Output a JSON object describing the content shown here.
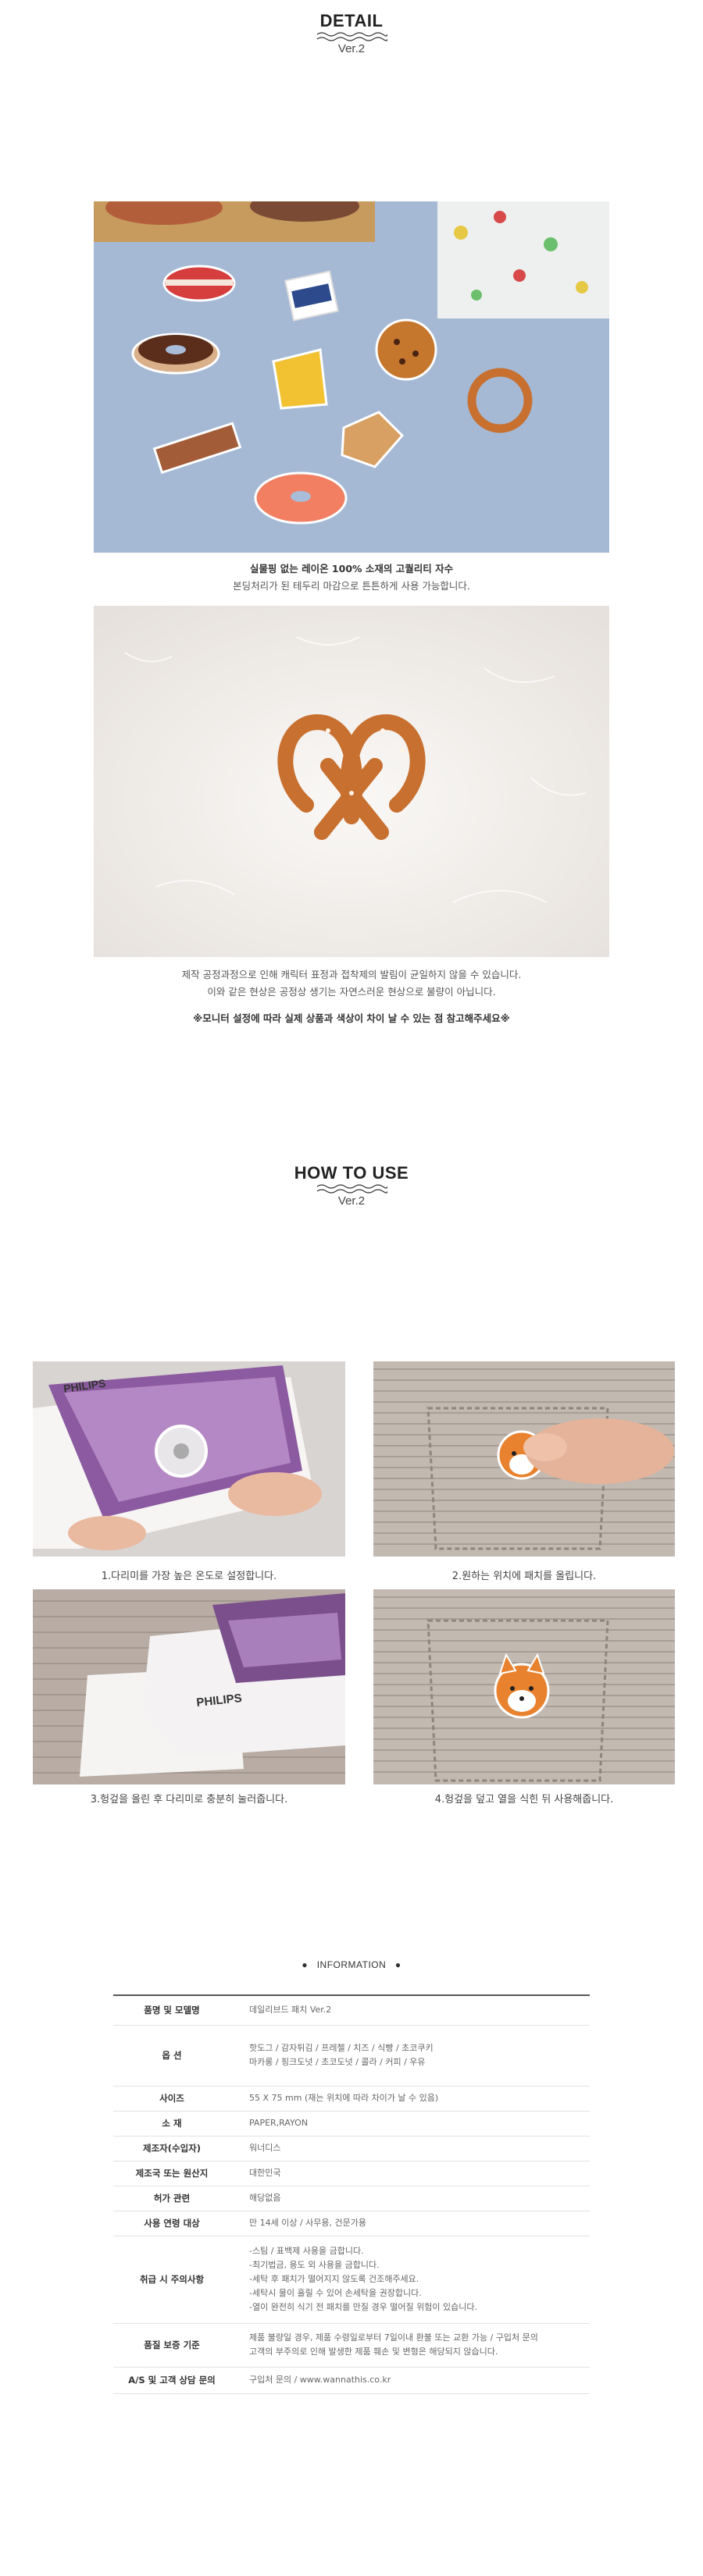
{
  "detail": {
    "title": "DETAIL",
    "version": "Ver.2",
    "caption1": {
      "line1": "실물핑 없는 레이온 100% 소재의 고퀄리티 자수",
      "line2": "본딩처리가 된 테두리 마감으로 튼튼하게 사용 가능합니다."
    },
    "caption2": {
      "line1": "제작 공정과정으로 인해 캐릭터 표정과 접착제의 발림이 균일하지 않을 수 있습니다.",
      "line2": "이와 같은 현상은 공정상 생기는 자연스러운 현상으로 불량이 아닙니다.",
      "notice": "※모니터 설정에 따라 실제 상품과 색상이 차이 날 수 있는 점 참고해주세요※"
    }
  },
  "howto": {
    "title": "HOW TO USE",
    "version": "Ver.2",
    "steps": [
      "1.다리미를 가장 높은 온도로 설정합니다.",
      "2.원하는 위치에 패치를 올립니다.",
      "3.헝겊을 올린 후 다리미로 충분히 눌러줍니다.",
      "4.헝겊을 덮고 열을 식힌 뒤 사용해줍니다."
    ],
    "iron_brand": "PHILIPS"
  },
  "information": {
    "heading": "INFORMATION",
    "rows": [
      {
        "key": "품명 및 모델명",
        "value": "데일리브드 패치 Ver.2"
      },
      {
        "key": "옵 션",
        "value": "핫도그 / 감자튀김 / 프레첼 / 치즈 / 식빵 / 초코쿠키\n마카롱 / 핑크도넛 / 초코도넛 / 콜라 / 커피 / 우유"
      },
      {
        "key": "사이즈",
        "value": "55 X 75 mm (재는 위치에 따라 차이가 날 수 있음)"
      },
      {
        "key": "소 재",
        "value": "PAPER,RAYON"
      },
      {
        "key": "제조자(수입자)",
        "value": "워너디스"
      },
      {
        "key": "제조국 또는 원산지",
        "value": "대한민국"
      },
      {
        "key": "허가 관련",
        "value": "해당없음"
      },
      {
        "key": "사용 연령 대상",
        "value": "만 14세 이상 / 사무용, 건문가용"
      },
      {
        "key": "취급 시 주의사항",
        "value": "-스팀 / 표백제 사용을 금합니다.\n-최기법금, 용도 외 사용을 금합니다.\n-세탁 후 패치가 떨어지지 않도록 건조해주세요.\n-세탁시 물이 흘릴 수 있어 손세탁을 권장합니다.\n-열이 완전히 식기 전 패치를 만질 경우 떨어질 위험이 있습니다."
      },
      {
        "key": "품질 보증 기준",
        "value": "제품 불량일 경우, 제품 수령일로부터 7일이내 환불 또는 교환 가능 / 구입처 문의\n고객의 부주의로 인해 발생한 제품 훼손 및 변형은 해당되지 않습니다."
      },
      {
        "key": "A/S 및 고객 상담 문의",
        "value": "구입처 문의 / www.wannathis.co.kr"
      }
    ]
  },
  "colors": {
    "photo_blue": "#a9bcd8",
    "fur_white": "#f4f1ee",
    "pretzel": "#c8702f",
    "fabric_gray": "#b7aea6",
    "iron_purple": "#7a4f8c"
  }
}
